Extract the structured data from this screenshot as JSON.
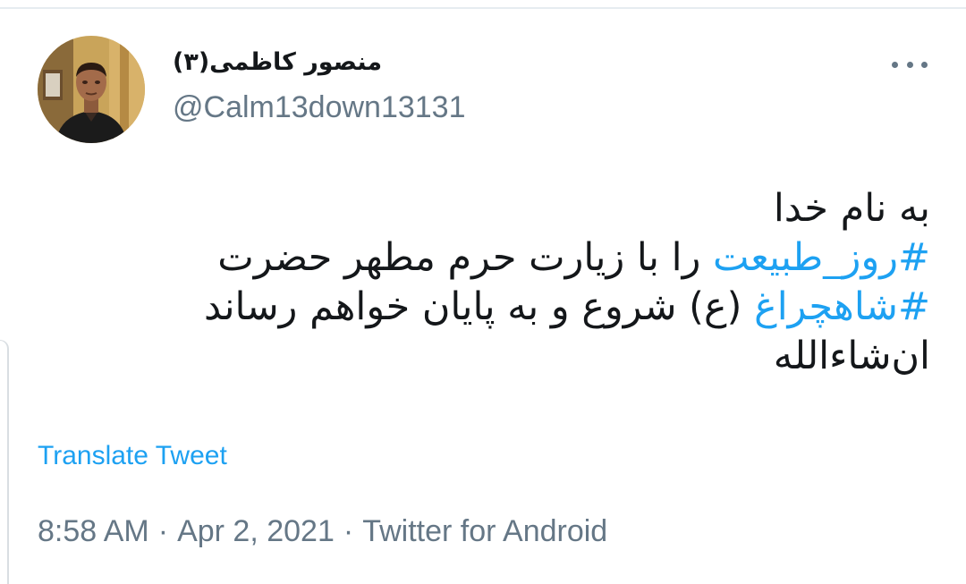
{
  "tweet": {
    "author": {
      "display_name": "منصور کاظمی(۳)",
      "handle": "@Calm13down13131",
      "avatar_icon": "user-avatar-photo"
    },
    "more_icon": "more-options-icon",
    "body": {
      "line1": "به نام خدا",
      "line2_hashtag": "#روز_طبیعت",
      "line2_rest": " را با زیارت حرم مطهر حضرت",
      "line3_hashtag": "#شاهچراغ",
      "line3_rest": " (ع) شروع و به پایان خواهم رساند",
      "line4": "ان‌شاءالله"
    },
    "translate_label": "Translate Tweet",
    "time": "8:58 AM",
    "date": "Apr 2, 2021",
    "source": "Twitter for Android",
    "separator": "·"
  },
  "colors": {
    "link": "#1da1f2",
    "text": "#14171a",
    "muted": "#657786",
    "background": "#ffffff"
  }
}
